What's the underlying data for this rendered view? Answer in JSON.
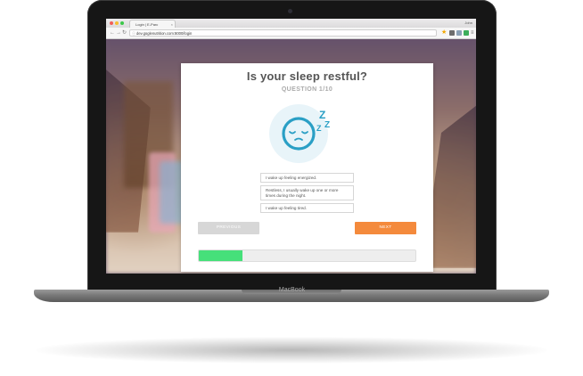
{
  "device": {
    "brand_label": "MacBook"
  },
  "browser": {
    "tab_title": "Login | E-Parc",
    "profile_name": "John",
    "url": "dev.goglenutrition.com:8000/login",
    "extension_icons": [
      "star-icon",
      "extension-icon",
      "extension-icon",
      "extension-icon"
    ]
  },
  "quiz": {
    "title": "Is your sleep restful?",
    "subtitle": "QUESTION 1/10",
    "icon": "sleeping-face-icon",
    "icon_letters": [
      "Z",
      "Z",
      "Z"
    ],
    "answers": [
      "I wake up feeling energized.",
      "Restless, I usually wake up one or more times during the night.",
      "I wake up feeling tired."
    ],
    "prev_label": "PREVIOUS",
    "next_label": "NEXT",
    "progress_fraction": 0.2,
    "colors": {
      "accent_next": "#f48a3c",
      "progress": "#46e07a",
      "icon": "#2a9fc5",
      "icon_bg": "#e8f4f9"
    }
  }
}
